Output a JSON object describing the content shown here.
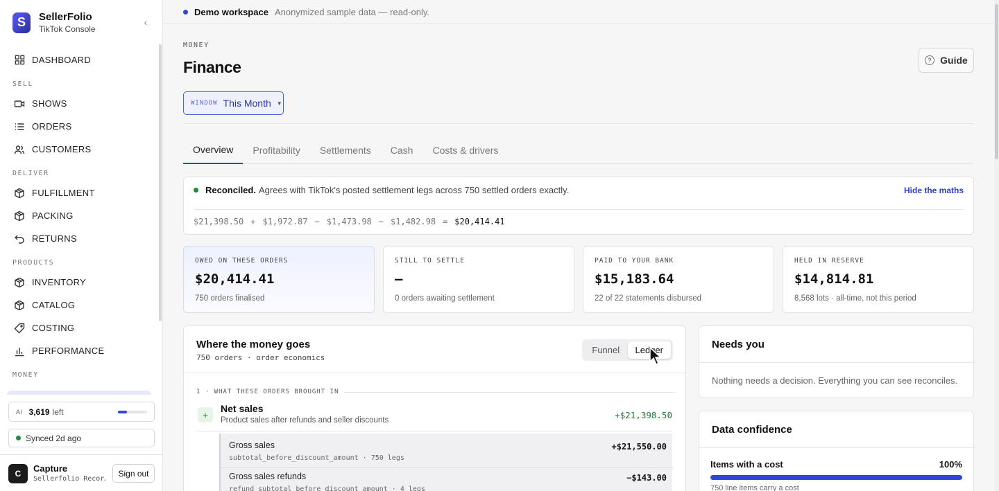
{
  "brand": {
    "name": "SellerFolio",
    "subtitle": "TikTok Console",
    "logo_letter": "S"
  },
  "sidebar": {
    "sections": [
      {
        "label": "",
        "items": [
          {
            "label": "DASHBOARD",
            "icon": "dashboard-icon"
          }
        ]
      },
      {
        "label": "SELL",
        "items": [
          {
            "label": "SHOWS",
            "icon": "video-icon"
          },
          {
            "label": "ORDERS",
            "icon": "list-icon"
          },
          {
            "label": "CUSTOMERS",
            "icon": "users-icon"
          }
        ]
      },
      {
        "label": "DELIVER",
        "items": [
          {
            "label": "FULFILLMENT",
            "icon": "box-icon"
          },
          {
            "label": "PACKING",
            "icon": "box-icon"
          },
          {
            "label": "RETURNS",
            "icon": "return-icon"
          }
        ]
      },
      {
        "label": "PRODUCTS",
        "items": [
          {
            "label": "INVENTORY",
            "icon": "box-icon"
          },
          {
            "label": "CATALOG",
            "icon": "box-icon"
          },
          {
            "label": "COSTING",
            "icon": "tag-icon"
          },
          {
            "label": "PERFORMANCE",
            "icon": "bar-chart-icon"
          }
        ]
      },
      {
        "label": "MONEY",
        "items": []
      }
    ],
    "ai": {
      "tag": "AI",
      "count": "3,619",
      "suffix": "left",
      "usage_fraction": 0.3
    },
    "sync": {
      "text": "Synced 2d ago",
      "status_color": "#1e8a3c"
    },
    "user": {
      "initial": "C",
      "name": "Capture",
      "sub": "Sellerfolio Recor…",
      "signout": "Sign out"
    }
  },
  "banner": {
    "title": "Demo workspace",
    "text": "Anonymized sample data — read-only.",
    "dot_color": "#3146d8"
  },
  "page": {
    "eyebrow": "MONEY",
    "title": "Finance",
    "guide": "Guide",
    "window": {
      "tag": "WINDOW",
      "value": "This Month"
    },
    "tabs": [
      "Overview",
      "Profitability",
      "Settlements",
      "Cash",
      "Costs & drivers"
    ],
    "active_tab": 0
  },
  "reconcile": {
    "status": "Reconciled.",
    "text": "Agrees with TikTok's posted settlement legs across 750 settled orders exactly.",
    "toggle": "Hide the maths",
    "status_color": "#1e8a3c",
    "equation": [
      "$21,398.50",
      "+",
      "$1,972.87",
      "−",
      "$1,473.98",
      "−",
      "$1,482.98",
      "=",
      "$20,414.41"
    ]
  },
  "kpis": [
    {
      "label": "OWED ON THESE ORDERS",
      "value": "$20,414.41",
      "sub": "750 orders finalised"
    },
    {
      "label": "STILL TO SETTLE",
      "value": "—",
      "sub": "0 orders awaiting settlement"
    },
    {
      "label": "PAID TO YOUR BANK",
      "value": "$15,183.64",
      "sub": "22 of 22 statements disbursed"
    },
    {
      "label": "HELD IN RESERVE",
      "value": "$14,814.81",
      "sub": "8,568 lots · all-time, not this period"
    }
  ],
  "money": {
    "title": "Where the money goes",
    "sub": "750 orders · order economics",
    "toggle": [
      "Funnel",
      "Ledger"
    ],
    "toggle_active": 1,
    "section": "1 · WHAT THESE ORDERS BROUGHT IN",
    "net": {
      "chip": "+",
      "title": "Net sales",
      "sub": "Product sales after refunds and seller discounts",
      "amount": "+$21,398.50"
    },
    "details": [
      {
        "title": "Gross sales",
        "sub": "subtotal_before_discount_amount · 750 legs",
        "amount": "+$21,550.00"
      },
      {
        "title": "Gross sales refunds",
        "sub": "refund_subtotal_before_discount_amount · 4 legs",
        "amount": "−$143.00"
      }
    ]
  },
  "needs": {
    "title": "Needs you",
    "text": "Nothing needs a decision. Everything you can see reconciles."
  },
  "confidence": {
    "title": "Data confidence",
    "label": "Items with a cost",
    "pct": "100%",
    "fraction": 1.0,
    "sub": "750 line items carry a cost"
  }
}
